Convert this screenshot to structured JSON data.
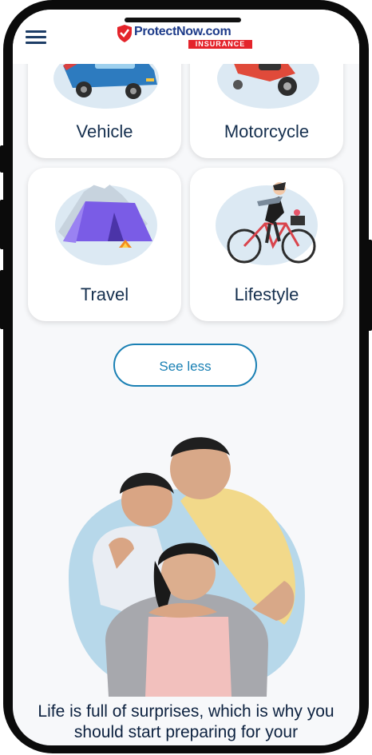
{
  "header": {
    "menu_icon": "hamburger-menu-icon",
    "logo": {
      "name": "ProtectNow.com",
      "sub": "INSURANCE",
      "icon": "shield-check-icon"
    }
  },
  "cards": [
    {
      "label": "Vehicle",
      "icon": "car-illustration"
    },
    {
      "label": "Motorcycle",
      "icon": "motorcycle-illustration"
    },
    {
      "label": "Travel",
      "icon": "tent-illustration"
    },
    {
      "label": "Lifestyle",
      "icon": "cyclist-illustration"
    }
  ],
  "see_less_label": "See less",
  "hero": {
    "image": "family-photo"
  },
  "tagline": "Life is full of surprises, which is why you should start preparing for your",
  "colors": {
    "brand_blue": "#1e3c8a",
    "brand_red": "#e4242b",
    "accent": "#1a80b4",
    "text_dark": "#16304f"
  }
}
